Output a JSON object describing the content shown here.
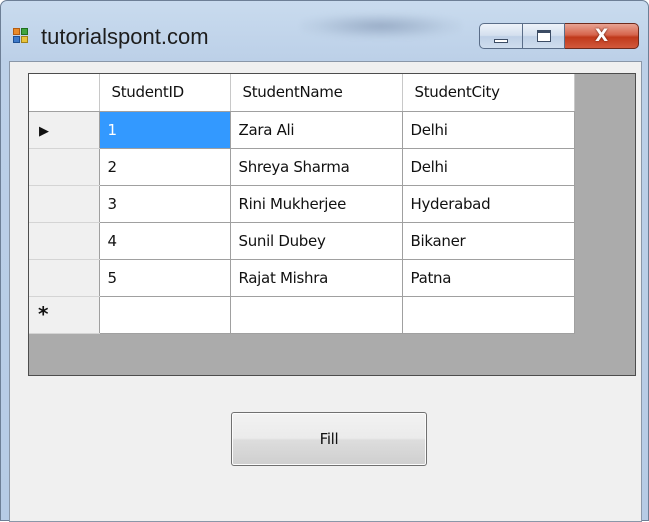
{
  "window": {
    "title": "tutorialspont.com",
    "close_glyph": "X"
  },
  "grid": {
    "columns": [
      "StudentID",
      "StudentName",
      "StudentCity"
    ],
    "current_row_glyph": "▶",
    "new_row_glyph": "*",
    "selected_cell": "row 1, StudentID",
    "selection_color": "#3399ff",
    "rows": [
      {
        "id": "1",
        "name": "Zara Ali",
        "city": "Delhi"
      },
      {
        "id": "2",
        "name": "Shreya Sharma",
        "city": "Delhi"
      },
      {
        "id": "3",
        "name": "Rini Mukherjee",
        "city": "Hyderabad"
      },
      {
        "id": "4",
        "name": "Sunil Dubey",
        "city": "Bikaner"
      },
      {
        "id": "5",
        "name": "Rajat Mishra",
        "city": "Patna"
      }
    ]
  },
  "actions": {
    "fill_label": "Fill"
  },
  "icons": [
    "app-icon",
    "minimize-icon",
    "maximize-icon",
    "close-icon",
    "current-row-arrow-icon",
    "new-row-star-icon"
  ]
}
